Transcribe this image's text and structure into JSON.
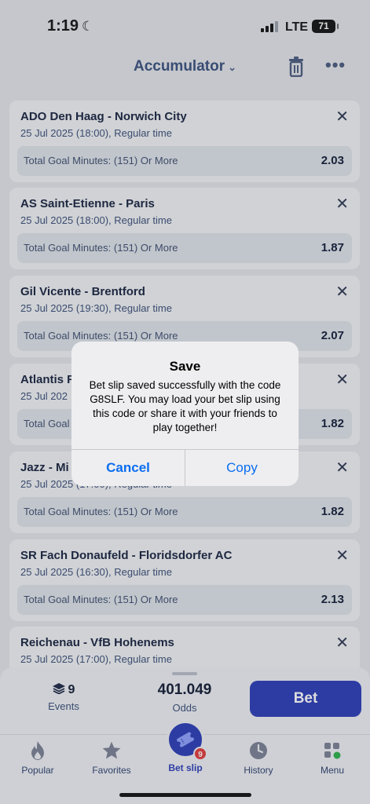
{
  "status_bar": {
    "time": "1:19",
    "network": "LTE",
    "battery": "71"
  },
  "header": {
    "title": "Accumulator"
  },
  "slips": [
    {
      "match": "ADO Den Haag - Norwich City",
      "when": "25 Jul 2025 (18:00), Regular time",
      "market": "Total Goal Minutes: (151) Or More",
      "odds": "2.03"
    },
    {
      "match": "AS Saint-Etienne - Paris",
      "when": "25 Jul 2025 (18:00), Regular time",
      "market": "Total Goal Minutes: (151) Or More",
      "odds": "1.87"
    },
    {
      "match": "Gil Vicente - Brentford",
      "when": "25 Jul 2025 (19:30), Regular time",
      "market": "Total Goal Minutes: (151) Or More",
      "odds": "2.07"
    },
    {
      "match": "Atlantis F",
      "when": "25 Jul 202",
      "market": "Total Goal",
      "odds": "1.82"
    },
    {
      "match": "Jazz - Mi",
      "when": "25 Jul 2025 (17:00), Regular time",
      "market": "Total Goal Minutes: (151) Or More",
      "odds": "1.82"
    },
    {
      "match": "SR Fach Donaufeld - Floridsdorfer AC",
      "when": "25 Jul 2025 (16:30), Regular time",
      "market": "Total Goal Minutes: (151) Or More",
      "odds": "2.13"
    },
    {
      "match": "Reichenau - VfB Hohenems",
      "when": "25 Jul 2025 (17:00), Regular time",
      "market": "",
      "odds": ""
    }
  ],
  "summary": {
    "events_count": "9",
    "events_label": "Events",
    "total_odds": "401.049",
    "odds_label": "Odds",
    "bet_label": "Bet"
  },
  "tabs": {
    "popular": "Popular",
    "favorites": "Favorites",
    "betslip": "Bet slip",
    "betslip_badge": "9",
    "history": "History",
    "menu": "Menu"
  },
  "dialog": {
    "title": "Save",
    "message": "Bet slip saved successfully with the code G8SLF. You may load your bet slip using this code or share it with your friends to play together!",
    "cancel": "Cancel",
    "copy": "Copy"
  },
  "colors": {
    "accent": "#2a3bb8",
    "ios_blue": "#0a6df0",
    "badge": "#e23a3a"
  }
}
